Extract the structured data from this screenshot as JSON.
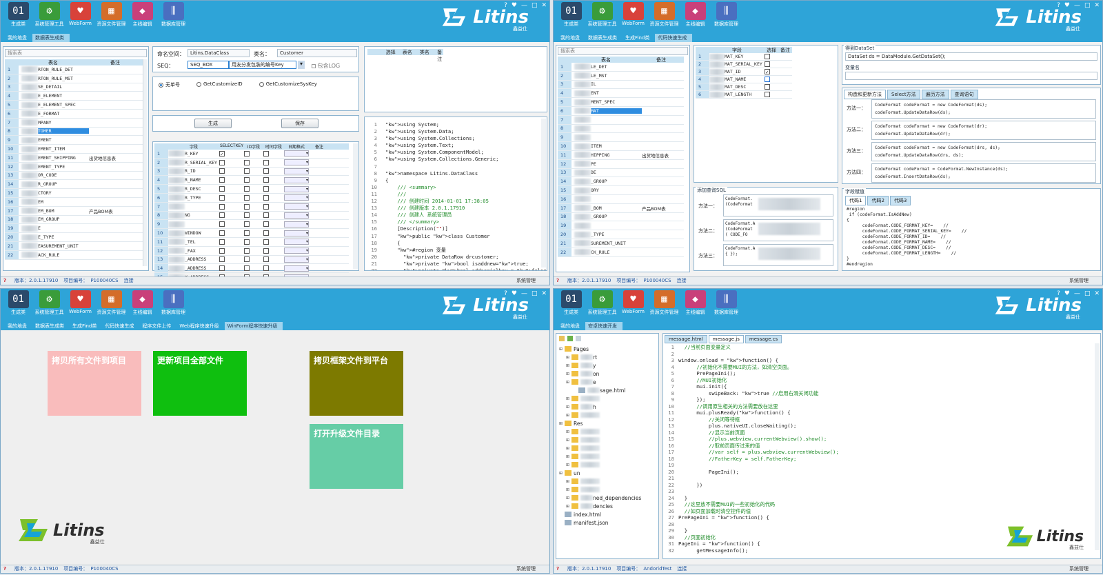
{
  "toolbar": {
    "items": [
      {
        "label": "生成类",
        "icon": "binary-icon",
        "color": "#2b4a6b"
      },
      {
        "label": "系统管理工具",
        "icon": "gear-icon",
        "color": "#3a9c3a"
      },
      {
        "label": "WebForm",
        "icon": "heart-form-icon",
        "color": "#d8423a"
      },
      {
        "label": "资源文件管理",
        "icon": "film-icon",
        "color": "#d46d2a"
      },
      {
        "label": "主线编辑",
        "icon": "cube-icon",
        "color": "#c9407a"
      },
      {
        "label": "数据库管理",
        "icon": "test-tube-icon",
        "color": "#4a6fc0"
      }
    ]
  },
  "brand": {
    "name": "Litins",
    "sub": "鑫益仕"
  },
  "window_controls": [
    "?",
    "♥",
    "—",
    "□",
    "✕"
  ],
  "status": {
    "version": "版本：2.0.1.17910",
    "project_label": "项目编号：",
    "project_code": "P100040CS",
    "link": "连接",
    "system": "系统管理",
    "q4_project": "AndoridTest"
  },
  "q1": {
    "tabs": [
      "我的地盘",
      "数据表生成类"
    ],
    "search_placeholder": "搜索表",
    "table_headers": [
      "表名",
      "备注"
    ],
    "tables": [
      {
        "no": "1",
        "name": "RTON_RULE_DET",
        "note": ""
      },
      {
        "no": "2",
        "name": "RTON_RULE_MST",
        "note": ""
      },
      {
        "no": "3",
        "name": "SE_DETAIL",
        "note": ""
      },
      {
        "no": "4",
        "name": "E_ELEMENT",
        "note": ""
      },
      {
        "no": "5",
        "name": "E_ELEMENT_SPEC",
        "note": ""
      },
      {
        "no": "6",
        "name": "E_FORMAT",
        "note": ""
      },
      {
        "no": "7",
        "name": "MPANY",
        "note": ""
      },
      {
        "no": "8",
        "name": "TOMER",
        "note": ""
      },
      {
        "no": "9",
        "name": "EMENT",
        "note": ""
      },
      {
        "no": "10",
        "name": "EMENT_ITEM",
        "note": ""
      },
      {
        "no": "11",
        "name": "EMENT_SHIPPING",
        "note": "出货地信息表"
      },
      {
        "no": "12",
        "name": "EMENT_TYPE",
        "note": ""
      },
      {
        "no": "13",
        "name": "OR_CODE",
        "note": ""
      },
      {
        "no": "14",
        "name": "R_GROUP",
        "note": ""
      },
      {
        "no": "15",
        "name": "CTORY",
        "note": ""
      },
      {
        "no": "16",
        "name": "EM",
        "note": ""
      },
      {
        "no": "17",
        "name": "EM_BOM",
        "note": "产品BOM表"
      },
      {
        "no": "18",
        "name": "EM_GROUP",
        "note": ""
      },
      {
        "no": "19",
        "name": "E",
        "note": ""
      },
      {
        "no": "20",
        "name": "E_TYPE",
        "note": ""
      },
      {
        "no": "21",
        "name": "EASUREMENT_UNIT",
        "note": ""
      },
      {
        "no": "22",
        "name": "ACK_RULE",
        "note": ""
      }
    ],
    "namespace_label": "命名空间：",
    "namespace_value": "Litins.DataClass",
    "class_label": "类名：",
    "class_value": "Customer",
    "seq_label": "SEQ：",
    "seq_value": "SEQ_BOX",
    "seq_desc": "用友分发包装的编号Key",
    "log_label": "包含LOG",
    "radios": [
      "无单号",
      "GetCustomizeID",
      "GetCustomizeSysKey"
    ],
    "generate_btn": "生成",
    "save_btn": "保存",
    "select_headers": [
      "选择",
      "表名",
      "类名",
      "备注"
    ],
    "field_headers": [
      "字段",
      "SELECTKEY",
      "ID字段",
      "时间字段",
      "日期格式",
      "备注"
    ],
    "fields": [
      {
        "no": "1",
        "name": "R_KEY",
        "checked": true
      },
      {
        "no": "2",
        "name": "R_SERIAL_KEY",
        "checked": false
      },
      {
        "no": "3",
        "name": "R_ID",
        "checked": false
      },
      {
        "no": "4",
        "name": "R_NAME",
        "checked": false
      },
      {
        "no": "5",
        "name": "R_DESC",
        "checked": false
      },
      {
        "no": "6",
        "name": "R_TYPE",
        "checked": false
      },
      {
        "no": "7",
        "name": "",
        "checked": false
      },
      {
        "no": "8",
        "name": "NG",
        "checked": false
      },
      {
        "no": "9",
        "name": "",
        "checked": false
      },
      {
        "no": "10",
        "name": "WINDOW",
        "checked": false
      },
      {
        "no": "11",
        "name": "_TEL",
        "checked": false
      },
      {
        "no": "12",
        "name": "_FAX",
        "checked": false
      },
      {
        "no": "13",
        "name": "_ADDRESS",
        "checked": false
      },
      {
        "no": "14",
        "name": "_ADDRESS",
        "checked": false
      },
      {
        "no": "15",
        "name": "Y_ADDRESS",
        "checked": false
      }
    ],
    "code_lines": [
      "using System;",
      "using System.Data;",
      "using System.Collections;",
      "using System.Text;",
      "using System.ComponentModel;",
      "using System.Collections.Generic;",
      "",
      "namespace Litins.DataClass",
      "{",
      "    /// <summary>",
      "    ///",
      "    /// 创建时间 2014-01-01 17:38:05",
      "    /// 创建版本 2.0.1.17910",
      "    /// 创建人 系统管理员",
      "    /// </summary>",
      "    [Description(\"\")]",
      "    public class Customer",
      "    {",
      "    #region 变量",
      "      private DataRow drcustomer;",
      "      private bool isaddnew=true;",
      "      private bool addserialkey = false;"
    ]
  },
  "q2": {
    "tabs": [
      "我的地盘",
      "数据表生成类",
      "生成Find类",
      "代码快速生成"
    ],
    "search_placeholder": "搜索表",
    "table_headers": [
      "表名",
      "备注"
    ],
    "tables": [
      {
        "no": "1",
        "name": "LE_DET",
        "note": ""
      },
      {
        "no": "2",
        "name": "LE_MST",
        "note": ""
      },
      {
        "no": "3",
        "name": "IL",
        "note": ""
      },
      {
        "no": "4",
        "name": "ENT",
        "note": ""
      },
      {
        "no": "5",
        "name": "MENT_SPEC",
        "note": ""
      },
      {
        "no": "6",
        "name": "MAT",
        "note": ""
      },
      {
        "no": "7",
        "name": "",
        "note": ""
      },
      {
        "no": "8",
        "name": "",
        "note": ""
      },
      {
        "no": "9",
        "name": "",
        "note": ""
      },
      {
        "no": "10",
        "name": "ITEM",
        "note": ""
      },
      {
        "no": "11",
        "name": "HIPPING",
        "note": "出货地信息表"
      },
      {
        "no": "12",
        "name": "PE",
        "note": ""
      },
      {
        "no": "13",
        "name": "DE",
        "note": ""
      },
      {
        "no": "14",
        "name": "_GROUP",
        "note": ""
      },
      {
        "no": "15",
        "name": "ORY",
        "note": ""
      },
      {
        "no": "16",
        "name": "",
        "note": ""
      },
      {
        "no": "17",
        "name": "_BOM",
        "note": "产品BOM表"
      },
      {
        "no": "18",
        "name": "_GROUP",
        "note": ""
      },
      {
        "no": "19",
        "name": "",
        "note": ""
      },
      {
        "no": "20",
        "name": "_TYPE",
        "note": ""
      },
      {
        "no": "21",
        "name": "SUREMENT_UNIT",
        "note": ""
      },
      {
        "no": "22",
        "name": "CK_RULE",
        "note": ""
      }
    ],
    "field_headers": [
      "字段",
      "选择",
      "备注"
    ],
    "fields": [
      {
        "no": "1",
        "name": "MAT_KEY",
        "checked": false
      },
      {
        "no": "2",
        "name": "MAT_SERIAL_KEY",
        "checked": false
      },
      {
        "no": "3",
        "name": "MAT_ID",
        "checked": true
      },
      {
        "no": "4",
        "name": "MAT_NAME",
        "checked": false
      },
      {
        "no": "5",
        "name": "MAT_DESC",
        "checked": false
      },
      {
        "no": "6",
        "name": "MAT_LENGTH",
        "checked": false
      }
    ],
    "dataset_legend": "得到DataSet",
    "dataset_value": "DataSet ds = DataModule.GetDataSet();",
    "varname_legend": "变量名",
    "method_tabs": [
      "构造和更新方法",
      "Select方法",
      "遍历方法",
      "查询语句"
    ],
    "methods": [
      {
        "label": "方法一：",
        "l1": "CodeFormat codeFormat = new CodeFormat(ds);",
        "l2": "codeFormat.UpdateDataRow(ds);"
      },
      {
        "label": "方法二：",
        "l1": "CodeFormat codeFormat = new CodeFormat(dr);",
        "l2": "codeFormat.UpdateDataRow(dr);"
      },
      {
        "label": "方法三：",
        "l1": "CodeFormat codeFormat = new CodeFormat(drs, ds);",
        "l2": "codeFormat.UpdateDataRow(drs, ds);"
      },
      {
        "label": "方法四：",
        "l1": "CodeFormat codeFormat = CodeFormat.NewInstance(ds);",
        "l2": "codeFormat.InsertDataRow(ds);"
      }
    ],
    "add_query_legend": "添加查询SQL",
    "add_methods": [
      {
        "label": "方法一：",
        "text": "CodeFormat.\n(CodeFormat"
      },
      {
        "label": "方法二：",
        "text": "CodeFormat.A\n(CodeFormat\n( CODE_FO"
      },
      {
        "label": "方法三：",
        "text": "CodeFormat.A\n{ });"
      }
    ],
    "fields_legend": "字段赋值",
    "code_tabs": [
      "代码1",
      "代码2",
      "代码3"
    ],
    "field_code": "#region\n if (codeFormat.IsAddNew)\n{\n      codeFormat.CODE_FORMAT_KEY=    //\n      codeFormat.CODE_FORMAT_SERIAL_KEY=    //\n      codeFormat.CODE_FORMAT_ID=    //\n      codeFormat.CODE_FORMAT_NAME=    //\n      codeFormat.CODE_FORMAT_DESC=    //\n      codeFormat.CODE_FORMAT_LENGTH=    //\n}\n#endregion"
  },
  "q3": {
    "tabs": [
      "我的地盘",
      "数据表生成类",
      "生成Find类",
      "代码快速生成",
      "程序文件上传",
      "Web程序快速升级",
      "WinForm程序快速升级"
    ],
    "tiles": [
      {
        "label": "拷贝所有文件到项目",
        "color": "#f9bcbc"
      },
      {
        "label": "更新项目全部文件",
        "color": "#0fbf0f"
      },
      {
        "label": "拷贝框架文件到平台",
        "color": "#7d7a00"
      },
      {
        "label": "打开升级文件目录",
        "color": "#66cda6"
      }
    ]
  },
  "q4": {
    "tabs": [
      "我的地盘",
      "安卓快速开发"
    ],
    "tree": [
      {
        "label": "Pages",
        "indent": 0
      },
      {
        "label": "rt",
        "indent": 1
      },
      {
        "label": "y",
        "indent": 1
      },
      {
        "label": "on",
        "indent": 1
      },
      {
        "label": "e",
        "indent": 1
      },
      {
        "label": "sage.html",
        "indent": 2
      },
      {
        "label": "",
        "indent": 1
      },
      {
        "label": "h",
        "indent": 1
      },
      {
        "label": "",
        "indent": 1
      },
      {
        "label": "Res",
        "indent": 0
      },
      {
        "label": "",
        "indent": 1
      },
      {
        "label": "",
        "indent": 1
      },
      {
        "label": "",
        "indent": 1
      },
      {
        "label": "",
        "indent": 1
      },
      {
        "label": "",
        "indent": 1
      },
      {
        "label": "un",
        "indent": 0
      },
      {
        "label": "",
        "indent": 1
      },
      {
        "label": "",
        "indent": 1
      },
      {
        "label": "ned_dependencies",
        "indent": 1
      },
      {
        "label": "dencies",
        "indent": 1
      },
      {
        "label": "index.html",
        "indent": 0
      },
      {
        "label": "manifest.json",
        "indent": 0
      }
    ],
    "code_tabs": [
      "message.html",
      "message.js",
      "message.cs"
    ],
    "code_lines": [
      "  //当前页面变量定义",
      "",
      "window.onload = function() {",
      "      //初始化不需要MUI的方法，如清空页面。",
      "      PrePageIni();",
      "      //MUI初始化",
      "      mui.init({",
      "          swipeBack: true //启用右滑关闭功能",
      "      });",
      "      //调用原生相关的方法需要放在这里",
      "      mui.plusReady(function() {",
      "          //关闭等待框",
      "          plus.nativeUI.closeWaiting();",
      "          //显示当前页面",
      "          //plus.webview.currentWebview().show();",
      "          //取前页面传过来的值",
      "          //var self = plus.webview.currentWebview();",
      "          //FatherKey = self.FatherKey;",
      "",
      "          PageIni();",
      "",
      "      })",
      "",
      "  }",
      "  //这里放不需要MUI的一些初始化的代码",
      "  //如页面加载时清空控件的值",
      "PrePageIni = function() {",
      "",
      "  }",
      "  //页面初始化",
      "PageIni = function() {",
      "      getMessageInfo();"
    ]
  }
}
